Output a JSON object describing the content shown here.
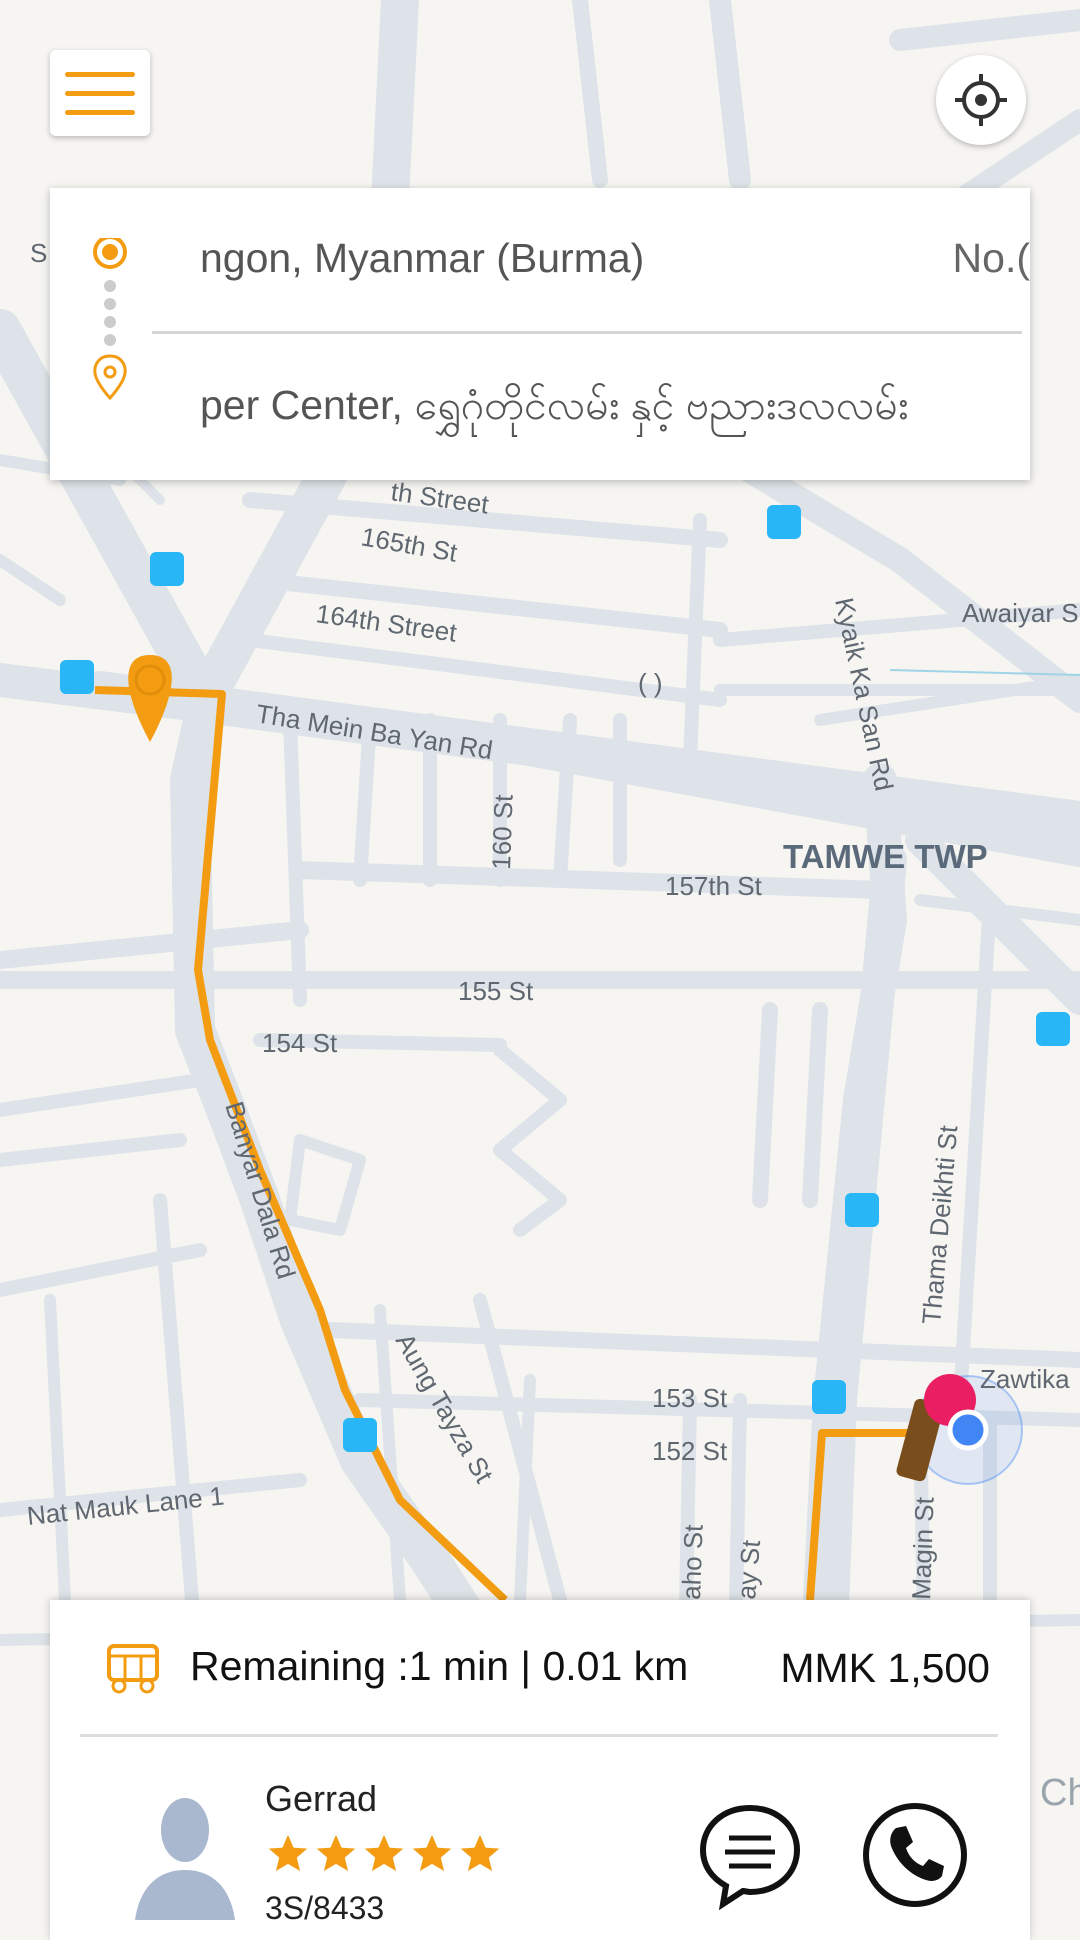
{
  "map": {
    "district_label": "TAMWE TWP",
    "streets": {
      "s_165th": "165th St",
      "s_164th": "164th Street",
      "s_street_top": "th Street",
      "tha_mein": "Tha Mein Ba Yan Rd",
      "s_160": "160 St",
      "s_157th": "157th St",
      "s_155": "155 St",
      "s_154": "154 St",
      "banyar": "Banyar Dala Rd",
      "aung": "Aung Tayza St",
      "s_153": "153 St",
      "s_152": "152 St",
      "nat_mauk": "Nat Mauk Lane 1",
      "kyaik": "Kyaik Ka San Rd",
      "awaiyar": "Awaiyar S",
      "thama": "Thama Deikhti St",
      "zawtika": "Zawtika",
      "paren": "( )",
      "aho": "aho St",
      "ay": "ay St",
      "magin": "Magin St",
      "s_left": "S"
    },
    "route_color": "#f39c12",
    "road_color": "#dde3e8"
  },
  "search": {
    "pickup_text": "ngon, Myanmar (Burma)",
    "pickup_extra": "No.(",
    "dropoff_text": "per Center, ရွှေဂုံတိုင်လမ်း နှင့် ဗညားဒလလမ်း"
  },
  "trip": {
    "remaining": "Remaining :1 min | 0.01 km",
    "price": "MMK 1,500"
  },
  "driver": {
    "name": "Gerrad",
    "rating": 5,
    "plate": "3S/8433"
  },
  "edge_text": "Ch",
  "accent_color": "#f39c12"
}
